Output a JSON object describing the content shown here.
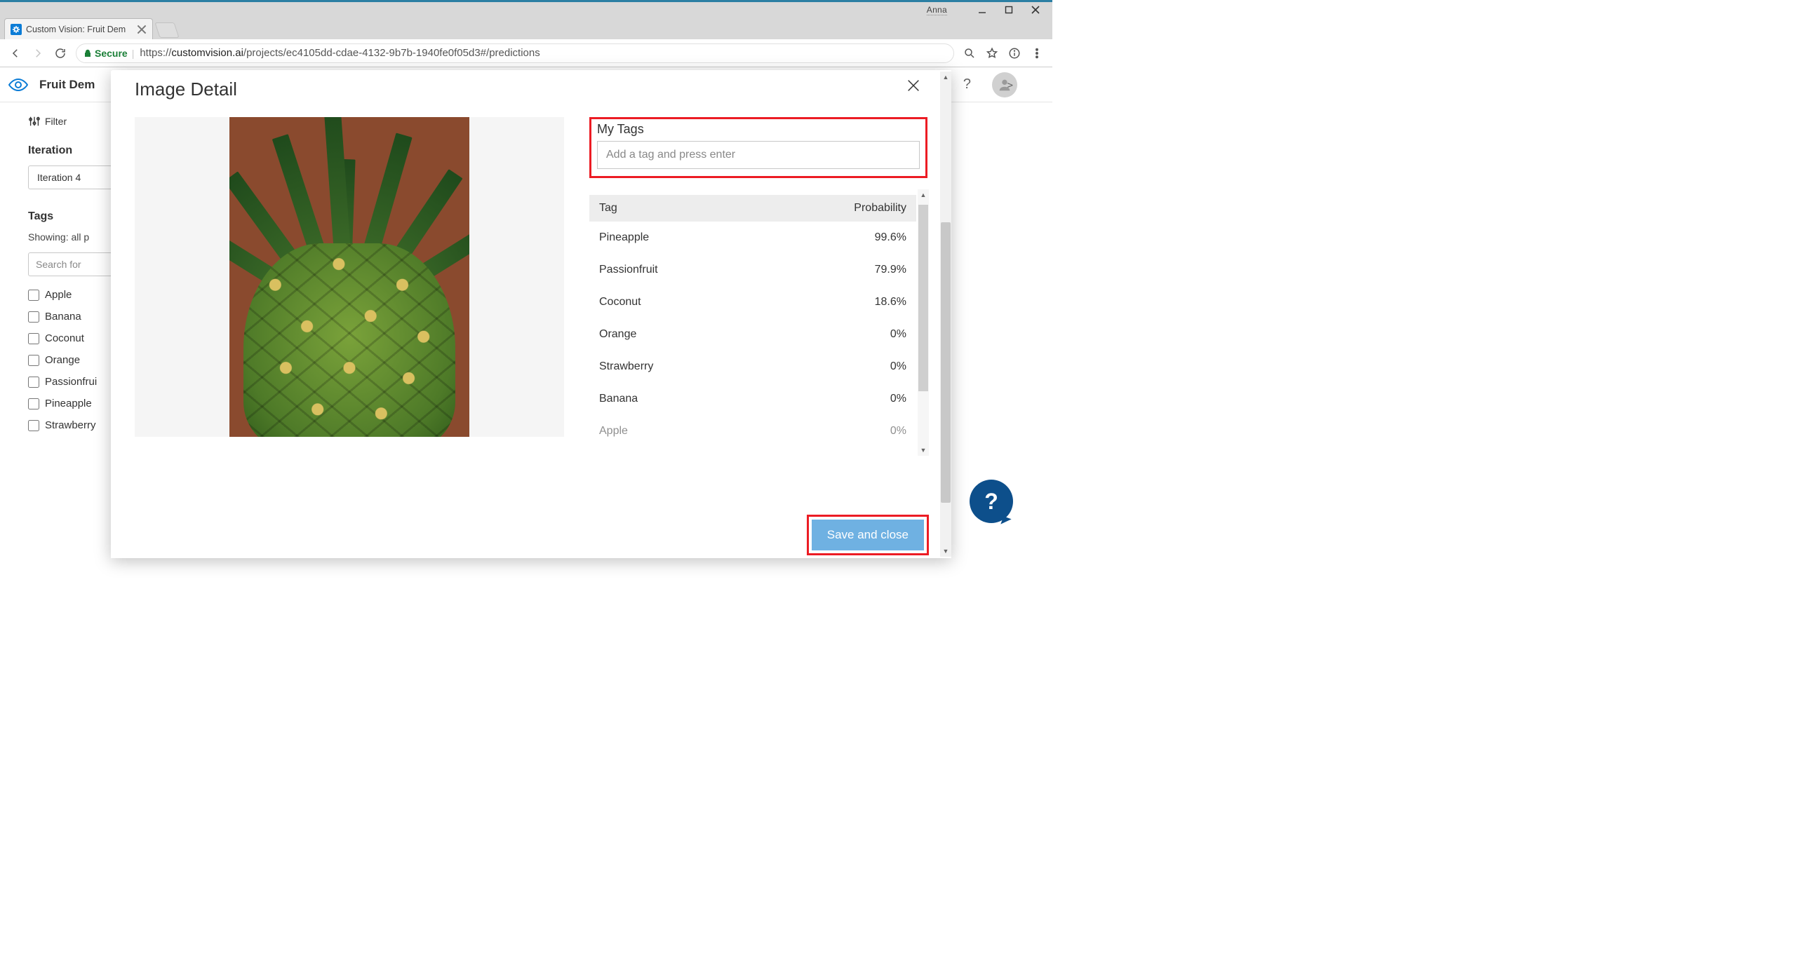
{
  "window": {
    "user": "Anna"
  },
  "browser": {
    "tab_title": "Custom Vision: Fruit Dem",
    "secure_label": "Secure",
    "url_prefix_scheme": "https://",
    "url_host": "customvision.ai",
    "url_path": "/projects/ec4105dd-cdae-4132-9b7b-1940fe0f05d3#/predictions"
  },
  "app_header": {
    "project_name": "Fruit Dem",
    "help_glyph": "?",
    "chevron_glyph": ">"
  },
  "sidebar": {
    "filter_label": "Filter",
    "iteration_heading": "Iteration",
    "iteration_selected": "Iteration 4",
    "tags_heading": "Tags",
    "showing_text": "Showing: all p",
    "search_placeholder": "Search for",
    "tags": [
      "Apple",
      "Banana",
      "Coconut",
      "Orange",
      "Passionfrui",
      "Pineapple",
      "Strawberry"
    ]
  },
  "modal": {
    "title": "Image Detail",
    "my_tags_label": "My Tags",
    "tag_input_placeholder": "Add a tag and press enter",
    "table": {
      "col_tag": "Tag",
      "col_prob": "Probability",
      "rows": [
        {
          "tag": "Pineapple",
          "prob": "99.6%"
        },
        {
          "tag": "Passionfruit",
          "prob": "79.9%"
        },
        {
          "tag": "Coconut",
          "prob": "18.6%"
        },
        {
          "tag": "Orange",
          "prob": "0%"
        },
        {
          "tag": "Strawberry",
          "prob": "0%"
        },
        {
          "tag": "Banana",
          "prob": "0%"
        },
        {
          "tag": "Apple",
          "prob": "0%",
          "faded": true
        }
      ]
    },
    "save_label": "Save and close"
  },
  "help_fab": "?"
}
